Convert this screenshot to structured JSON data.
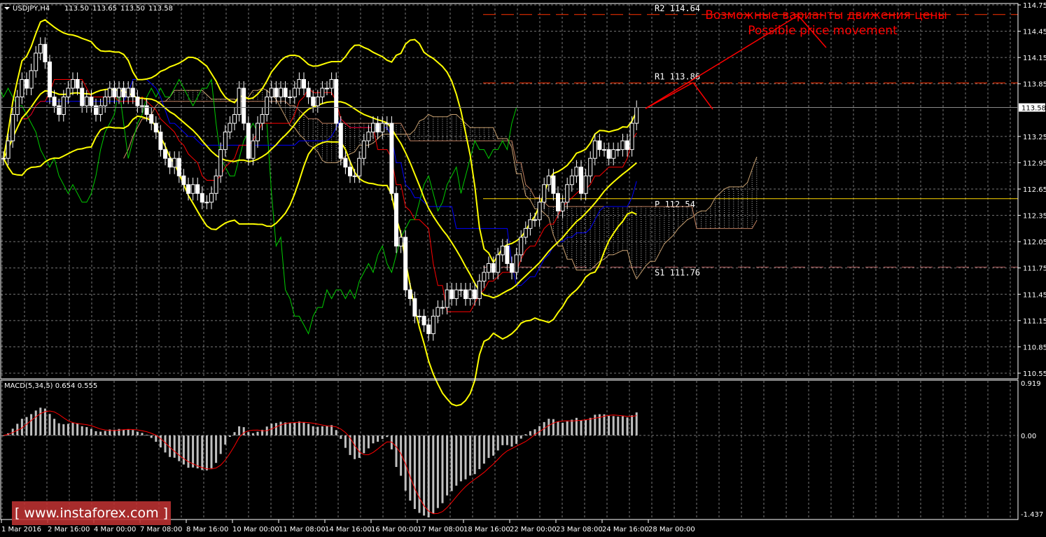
{
  "header": {
    "symbol": "USDJPY,H4",
    "open": "113.50",
    "high": "113.65",
    "low": "113.50",
    "close": "113.58"
  },
  "annotation": {
    "line_ru": "Возможные варианты движения цены",
    "line_en": "Possible price movement",
    "color": "#ff0000"
  },
  "levels": [
    {
      "label": "R2 114.64",
      "price": 114.64,
      "color": "#ff3300",
      "style": "dashed"
    },
    {
      "label": "R1 113.86",
      "price": 113.86,
      "color": "#ff3300",
      "style": "dashed"
    },
    {
      "label": "P 112.54",
      "price": 112.54,
      "color": "#ffd700",
      "style": "solid"
    },
    {
      "label": "S1 111.76",
      "price": 111.76,
      "color": "#b06060",
      "style": "dashed"
    }
  ],
  "current_price": "113.58",
  "macd": {
    "label": "MACD(5,34,5) 0.654 0.555",
    "axis": [
      "0.919",
      "0.00",
      "-1.437"
    ],
    "ylim": [
      -1.437,
      0.919
    ]
  },
  "watermark": "[ www.instaforex.com ]",
  "chart_data": {
    "type": "candlestick",
    "title": "USDJPY,H4",
    "timeframe": "H4",
    "ylim": [
      110.55,
      114.75
    ],
    "y_ticks": [
      "114.75",
      "114.45",
      "114.15",
      "113.85",
      "113.58",
      "113.25",
      "112.95",
      "112.65",
      "112.35",
      "112.05",
      "111.75",
      "111.45",
      "111.15",
      "110.85",
      "110.55"
    ],
    "x_ticks": [
      "1 Mar 2016",
      "2 Mar 16:00",
      "4 Mar 00:00",
      "7 Mar 08:00",
      "8 Mar 16:00",
      "10 Mar 00:00",
      "11 Mar 08:00",
      "14 Mar 16:00",
      "16 Mar 00:00",
      "17 Mar 08:00",
      "18 Mar 16:00",
      "22 Mar 00:00",
      "23 Mar 08:00",
      "24 Mar 16:00",
      "28 Mar 00:00"
    ],
    "grid": true,
    "indicators": [
      "Bollinger Bands (yellow)",
      "Ichimoku (red, blue, green, cloud)",
      "MACD(5,34,5)"
    ],
    "closes": [
      113.0,
      113.2,
      113.5,
      113.7,
      113.9,
      113.8,
      114.0,
      114.2,
      114.3,
      114.1,
      113.7,
      113.6,
      113.5,
      113.7,
      113.8,
      113.9,
      113.8,
      113.6,
      113.7,
      113.6,
      113.5,
      113.6,
      113.7,
      113.8,
      113.7,
      113.8,
      113.7,
      113.8,
      113.7,
      113.6,
      113.6,
      113.5,
      113.4,
      113.3,
      113.1,
      113.0,
      112.9,
      113.0,
      112.8,
      112.7,
      112.6,
      112.7,
      112.6,
      112.5,
      112.5,
      112.6,
      112.8,
      113.1,
      113.3,
      113.4,
      113.5,
      113.8,
      113.4,
      113.0,
      113.2,
      113.4,
      113.5,
      113.7,
      113.8,
      113.7,
      113.8,
      113.7,
      113.7,
      113.8,
      113.9,
      113.8,
      113.7,
      113.6,
      113.7,
      113.8,
      113.8,
      113.9,
      113.4,
      113.0,
      112.9,
      112.8,
      112.8,
      113.0,
      113.2,
      113.3,
      113.4,
      113.3,
      113.4,
      113.4,
      112.6,
      112.0,
      112.1,
      111.5,
      111.4,
      111.2,
      111.2,
      111.1,
      111.0,
      111.2,
      111.3,
      111.3,
      111.5,
      111.4,
      111.5,
      111.5,
      111.4,
      111.5,
      111.4,
      111.6,
      111.7,
      111.8,
      111.7,
      111.9,
      112.0,
      111.8,
      111.7,
      111.9,
      112.1,
      112.2,
      112.3,
      112.3,
      112.5,
      112.7,
      112.8,
      112.6,
      112.4,
      112.5,
      112.7,
      112.8,
      112.9,
      112.6,
      112.8,
      113.0,
      113.2,
      113.1,
      113.1,
      113.0,
      113.1,
      113.1,
      113.2,
      113.1,
      113.4,
      113.58
    ]
  }
}
